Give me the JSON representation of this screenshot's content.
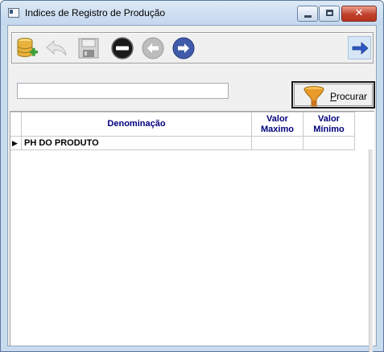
{
  "window": {
    "title": "Indices de Registro de Produção",
    "controls": {
      "minimize": "—",
      "maximize": "☐",
      "close": "✕"
    }
  },
  "toolbar": {
    "buttons": [
      {
        "name": "add-record",
        "icon": "database-add-icon"
      },
      {
        "name": "undo",
        "icon": "undo-arrow-icon",
        "disabled": true
      },
      {
        "name": "save",
        "icon": "floppy-disk-icon",
        "disabled": true
      },
      {
        "name": "delete",
        "icon": "minus-circle-icon"
      },
      {
        "name": "previous",
        "icon": "left-arrow-circle-icon",
        "disabled": true
      },
      {
        "name": "next",
        "icon": "right-arrow-circle-icon"
      }
    ],
    "exit": {
      "icon": "exit-arrow-icon"
    }
  },
  "search": {
    "value": "",
    "placeholder": ""
  },
  "procurar": {
    "label_prefix": "P",
    "label_rest": "rocurar",
    "icon": "funnel-icon"
  },
  "grid": {
    "columns": [
      {
        "label": "Denominação"
      },
      {
        "label_line1": "Valor",
        "label_line2": "Maximo"
      },
      {
        "label_line1": "Valor",
        "label_line2": "Mínimo"
      }
    ],
    "rows": [
      {
        "pointer": "▶",
        "denominacao": "PH DO PRODUTO",
        "valor_maximo": "",
        "valor_minimo": ""
      }
    ]
  },
  "colors": {
    "header_text": "#00007f",
    "accent": "#3f5ba9",
    "title_bar": "#c3d7ee"
  }
}
